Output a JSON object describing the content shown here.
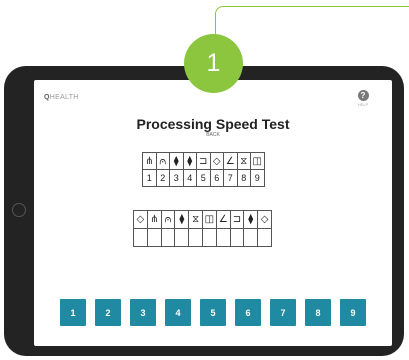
{
  "callout": {
    "number": "1"
  },
  "app": {
    "logo_strong": "Q",
    "logo_rest": "HEALTH",
    "help_icon": "?",
    "help_label": "HELP"
  },
  "test": {
    "title": "Processing Speed Test",
    "back_label": "BACK",
    "key_symbols": [
      "⋔",
      "⩀",
      "⧫",
      "⧫",
      "⊐",
      "◇",
      "∠",
      "⧖",
      "◫"
    ],
    "key_numbers": [
      "1",
      "2",
      "3",
      "4",
      "5",
      "6",
      "7",
      "8",
      "9"
    ],
    "task_symbols": [
      "◇",
      "⋔",
      "⩀",
      "⧫",
      "⧖",
      "◫",
      "∠",
      "⊐",
      "⧫",
      "◇"
    ],
    "task_answers": [
      "",
      "",
      "",
      "",
      "",
      "",
      "",
      "",
      "",
      ""
    ]
  },
  "keypad": {
    "buttons": [
      "1",
      "2",
      "3",
      "4",
      "5",
      "6",
      "7",
      "8",
      "9"
    ]
  },
  "colors": {
    "accent": "#8cc63f",
    "button": "#1f8aa1",
    "device": "#232323"
  }
}
